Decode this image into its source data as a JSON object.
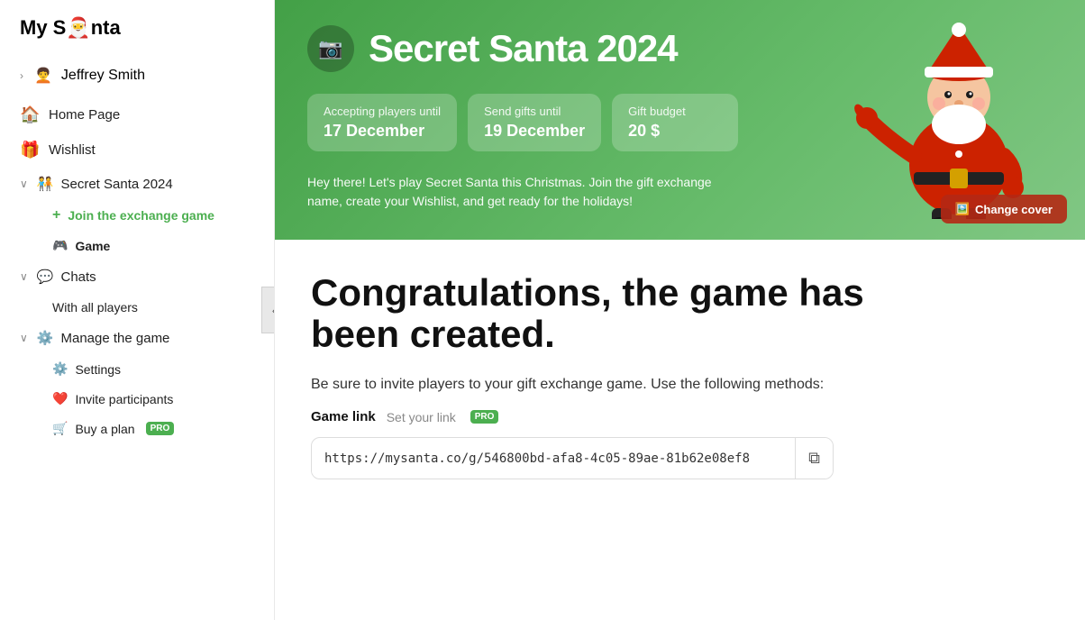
{
  "app": {
    "name": "My Santa",
    "logo_icon": "🎅"
  },
  "sidebar": {
    "user": {
      "name": "Jeffrey Smith",
      "avatar_emoji": "🧑‍🦱"
    },
    "items": [
      {
        "id": "home",
        "label": "Home Page",
        "icon": "🏠"
      },
      {
        "id": "wishlist",
        "label": "Wishlist",
        "icon": "🎁"
      }
    ],
    "secret_santa_group": {
      "label": "Secret Santa 2024",
      "icon": "🧑‍🤝‍🧑",
      "sub_items": [
        {
          "id": "join",
          "label": "Join the exchange game",
          "type": "join"
        },
        {
          "id": "game",
          "label": "Game",
          "icon": "🎮",
          "type": "active"
        }
      ]
    },
    "chats_group": {
      "label": "Chats",
      "icon": "💬",
      "sub_items": [
        {
          "id": "all_players",
          "label": "With all players"
        }
      ]
    },
    "manage_group": {
      "label": "Manage the game",
      "icon": "⚙️",
      "sub_items": [
        {
          "id": "settings",
          "label": "Settings",
          "icon": "⚙️"
        },
        {
          "id": "invite",
          "label": "Invite participants",
          "icon": "❤️"
        },
        {
          "id": "buy_plan",
          "label": "Buy a plan",
          "icon": "🛒",
          "badge": "PRO"
        }
      ]
    }
  },
  "hero": {
    "title": "Secret Santa 2024",
    "camera_icon": "📷",
    "cards": [
      {
        "label": "Accepting players until",
        "value": "17 December"
      },
      {
        "label": "Send gifts until",
        "value": "19 December"
      },
      {
        "label": "Gift budget",
        "value": "20 $"
      }
    ],
    "description": "Hey there! Let's play Secret Santa this Christmas. Join the gift exchange name, create your Wishlist, and get ready for the holidays!",
    "change_cover_label": "Change cover",
    "change_cover_icon": "🖼️"
  },
  "main": {
    "congrats_title": "Congratulations, the game has been created.",
    "invite_desc": "Be sure to invite players to your gift exchange game. Use the following methods:",
    "game_link_label": "Game link",
    "set_link_label": "Set your link",
    "pro_badge": "PRO",
    "game_url": "https://mysanta.co/g/546800bd-afa8-4c05-89ae-81b62e08ef8",
    "copy_icon": "⧉"
  }
}
